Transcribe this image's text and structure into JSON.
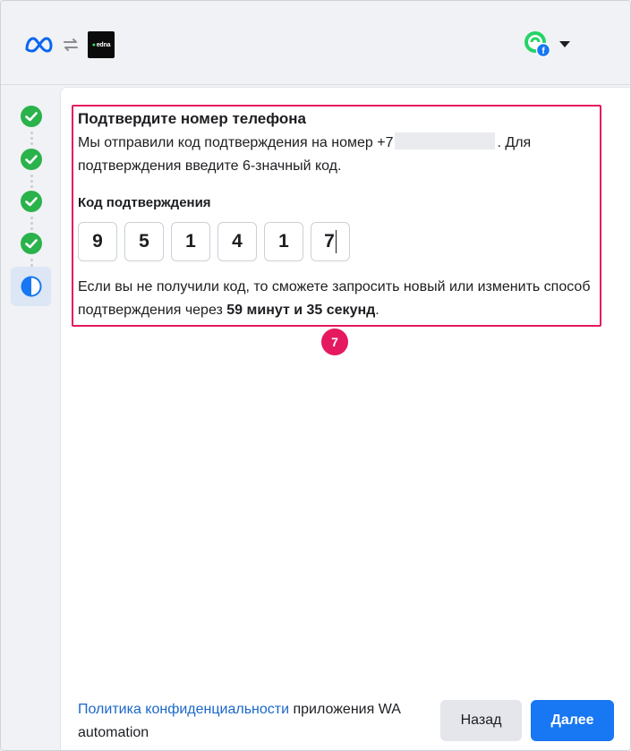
{
  "header": {
    "edna_logo_text": "edna"
  },
  "steps": [
    {
      "status": "complete",
      "icon": "check-circle-icon"
    },
    {
      "status": "complete",
      "icon": "check-circle-icon"
    },
    {
      "status": "complete",
      "icon": "check-circle-icon"
    },
    {
      "status": "complete",
      "icon": "check-circle-icon"
    },
    {
      "status": "in-progress",
      "icon": "half-circle-icon"
    }
  ],
  "verify": {
    "title": "Подтвердите номер телефона",
    "desc_before": "Мы отправили код подтверждения на номер +7",
    "desc_after": ". Для подтверждения введите 6-значный код.",
    "code_label": "Код подтверждения",
    "code_digits": [
      "9",
      "5",
      "1",
      "4",
      "1",
      "7"
    ],
    "resend_text": "Если вы не получили код, то сможете запросить новый или изменить способ подтверждения через",
    "resend_time": "59 минут и 35 секунд",
    "resend_end": "."
  },
  "badge": {
    "number": "7"
  },
  "footer": {
    "policy_link": "Политика конфиденциальности",
    "policy_rest": " приложения WA automation"
  },
  "buttons": {
    "back": "Назад",
    "next": "Далее"
  },
  "colors": {
    "accent": "#1877f2",
    "success": "#2ab24b",
    "highlight": "#e5195f",
    "link": "#1a67c9"
  }
}
